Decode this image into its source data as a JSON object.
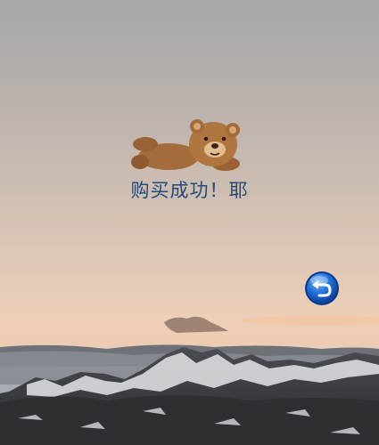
{
  "purchase": {
    "success_message": "购买成功！耶"
  },
  "icons": {
    "mascot": "teddy-bear-icon",
    "back": "undo-arrow-icon"
  },
  "colors": {
    "message_text": "#1f4a7a",
    "back_button": "#1e6fd8"
  }
}
